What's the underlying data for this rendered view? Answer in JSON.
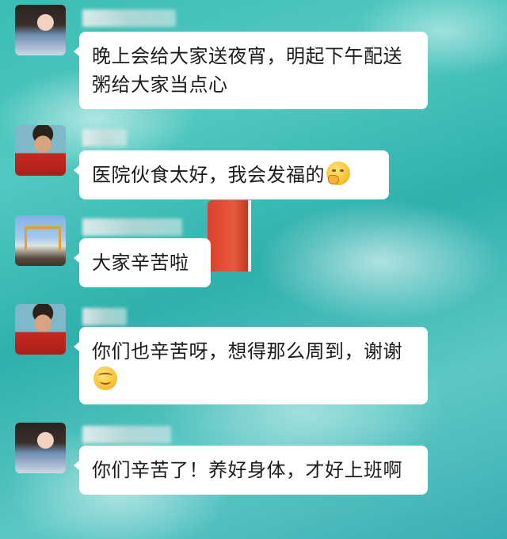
{
  "messages": [
    {
      "avatar": "girl-avatar",
      "text": "晚上会给大家送夜宵，明起下午配送粥给大家当点心",
      "emoji": null
    },
    {
      "avatar": "man-avatar",
      "text": "医院伙食太好，我会发福的",
      "emoji": "thinking-face-icon"
    },
    {
      "avatar": "beach-avatar",
      "text": "大家辛苦啦",
      "emoji": null
    },
    {
      "avatar": "man-avatar",
      "text": "你们也辛苦呀，想得那么周到，谢谢",
      "emoji": "smiling-face-icon"
    },
    {
      "avatar": "girl-avatar",
      "text": "你们辛苦了！养好身体，才好上班啊",
      "emoji": null
    }
  ]
}
